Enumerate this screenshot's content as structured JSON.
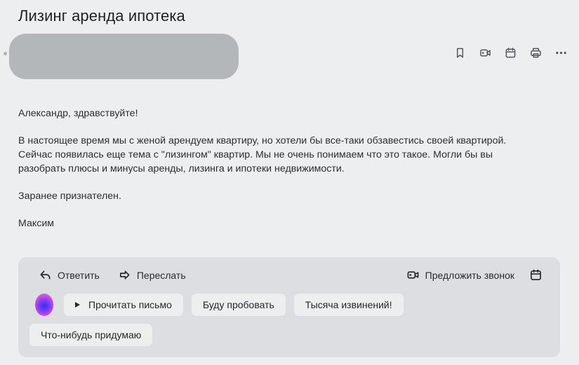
{
  "email": {
    "subject": "Лизинг аренда ипотека",
    "toolbar_icons": [
      "bookmark-icon",
      "video-call-icon",
      "calendar-icon",
      "print-icon",
      "more-icon"
    ],
    "body": {
      "greeting": "Александр, здравствуйте!",
      "paragraph": "В настоящее время мы с женой арендуем квартиру, но хотели бы все-таки обзавестись своей квартирой.\nСейчас появилась еще тема с \"лизингом\" квартир. Мы не очень понимаем что это такое. Могли бы вы\nразобрать плюсы и минусы аренды, лизинга и ипотеки недвижимости.",
      "closing": "Заранее признателен.",
      "signature": "Максим"
    }
  },
  "reply_panel": {
    "reply_label": "Ответить",
    "forward_label": "Переслать",
    "suggest_call_label": "Предложить звонок",
    "quick_replies": {
      "read_aloud": "Прочитать письмо",
      "will_try": "Буду пробовать",
      "thousand_apologies": "Тысяча извинений!",
      "think_of_something": "Что-нибудь придумаю"
    }
  }
}
